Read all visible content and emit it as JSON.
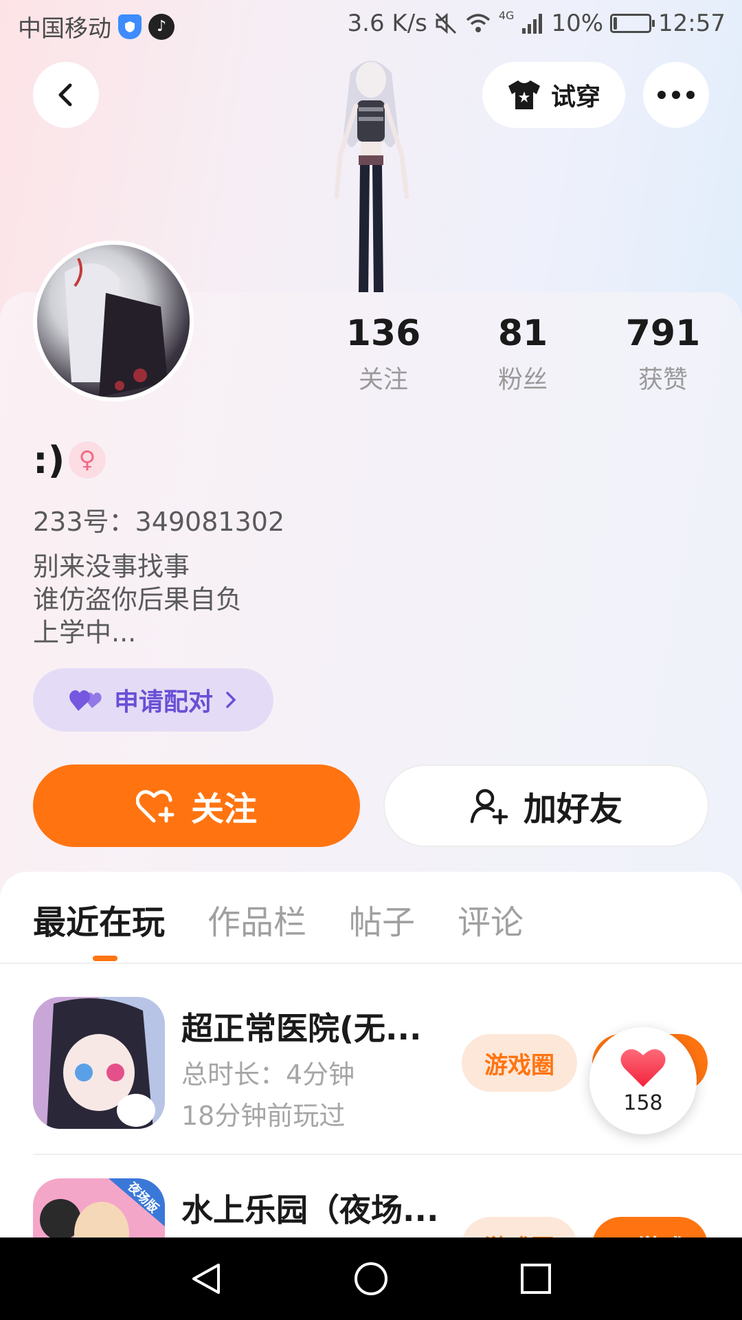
{
  "status_bar": {
    "carrier": "中国移动",
    "net_speed": "3.6 K/s",
    "network": "4G",
    "battery": "10%",
    "battery_level": 0.1,
    "time": "12:57"
  },
  "header": {
    "back_icon": "back-arrow-icon",
    "tryon_label": "试穿",
    "more_icon": "more-icon"
  },
  "stats": [
    {
      "value": "136",
      "label": "关注"
    },
    {
      "value": "81",
      "label": "粉丝"
    },
    {
      "value": "791",
      "label": "获赞"
    }
  ],
  "profile": {
    "nickname": ":)",
    "gender_symbol": "♀",
    "uid": "233号：349081302",
    "bio": [
      "别来没事找事",
      "谁仿盗你后果自负",
      "上学中..."
    ],
    "pair_label": "申请配对"
  },
  "actions": {
    "follow_label": "关注",
    "add_friend_label": "加好友"
  },
  "tabs": [
    {
      "label": "最近在玩",
      "active": true
    },
    {
      "label": "作品栏",
      "active": false
    },
    {
      "label": "帖子",
      "active": false
    },
    {
      "label": "评论",
      "active": false
    }
  ],
  "games": [
    {
      "title": "超正常医院(无...",
      "duration": "总时长：4分钟",
      "last_played": "18分钟前玩过",
      "circle_label": "游戏圈"
    },
    {
      "title": "水上乐园（夜场...",
      "badge": "夜场版",
      "circle_label": "游戏圈",
      "play_label": "玩游戏"
    }
  ],
  "like_bubble": {
    "count": "158"
  },
  "colors": {
    "accent": "#ff7411",
    "pair": "#6a4fd6"
  }
}
